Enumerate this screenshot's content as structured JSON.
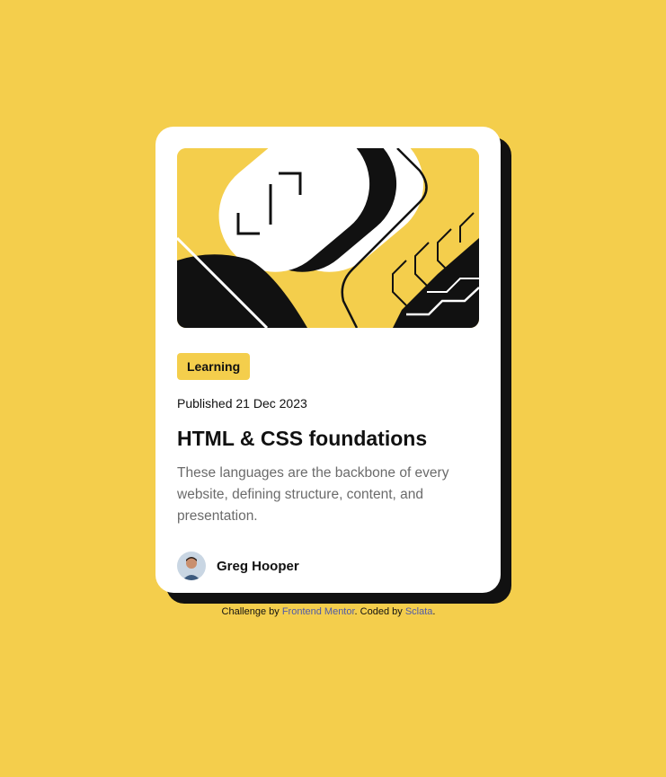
{
  "card": {
    "category": "Learning",
    "published": "Published 21 Dec 2023",
    "title": "HTML & CSS foundations",
    "description": "These languages are the backbone of every website, defining structure, content, and presentation.",
    "author": {
      "name": "Greg Hooper"
    }
  },
  "attribution": {
    "prefix": "Challenge by ",
    "challenge_link": "Frontend Mentor",
    "middle": ". Coded by ",
    "coder_link": "Sclata",
    "suffix": "."
  },
  "colors": {
    "background": "#F4CE4C",
    "card": "#FFFFFF",
    "text": "#111111",
    "muted": "#6B6B6B",
    "link": "#4F5AA8"
  }
}
